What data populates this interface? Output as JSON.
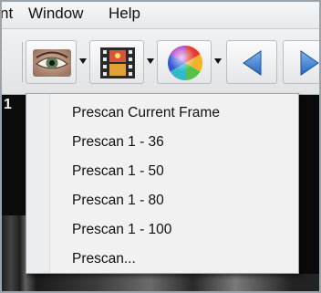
{
  "menubar": {
    "items": [
      "nt",
      "Window",
      "Help"
    ]
  },
  "toolbar": {
    "buttons": [
      {
        "icon": "eye-icon",
        "has_dropdown": true
      },
      {
        "icon": "film-strip-icon",
        "has_dropdown": true
      },
      {
        "icon": "color-wheel-icon",
        "has_dropdown": true
      },
      {
        "icon": "arrow-left-icon",
        "has_dropdown": false
      },
      {
        "icon": "arrow-right-icon",
        "has_dropdown": false
      }
    ]
  },
  "film": {
    "frame_number": "1"
  },
  "prescan_menu": {
    "items": [
      "Prescan Current Frame",
      "Prescan 1 - 36",
      "Prescan 1 - 50",
      "Prescan 1 - 80",
      "Prescan 1 - 100",
      "Prescan..."
    ]
  },
  "colors": {
    "arrow_blue": "#3b7fd4",
    "menu_bg": "#f1f1f1"
  }
}
